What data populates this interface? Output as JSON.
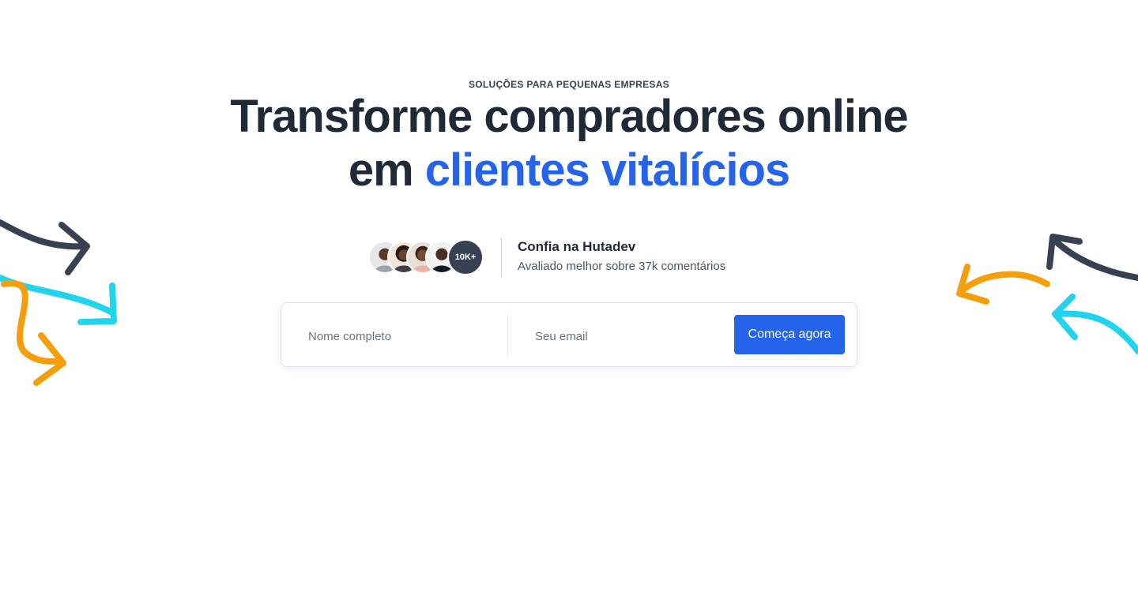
{
  "hero": {
    "eyebrow": "SOLUÇÕES PARA PEQUENAS EMPRESAS",
    "headline_line1": "Transforme compradores online",
    "headline_line2_prefix": "em ",
    "headline_line2_highlight": "clientes vitalícios"
  },
  "social_proof": {
    "avatars": [
      "avatar-person-1",
      "avatar-person-2",
      "avatar-person-3",
      "avatar-person-4"
    ],
    "count_badge": "10K+",
    "title": "Confia na Hutadev",
    "subtitle": "Avaliado melhor sobre 37k comentários"
  },
  "signup_form": {
    "name_placeholder": "Nome completo",
    "email_placeholder": "Seu email",
    "name_value": "",
    "email_value": "",
    "submit_label": "Começa agora"
  },
  "colors": {
    "accent": "#2563eb",
    "text_dark": "#1f2937",
    "arrow_dark": "#374151",
    "arrow_cyan": "#22d3ee",
    "arrow_orange": "#f59e0b"
  },
  "icons": {
    "decor_left": "curvy-arrows-decoration",
    "decor_right": "curvy-arrows-decoration"
  }
}
